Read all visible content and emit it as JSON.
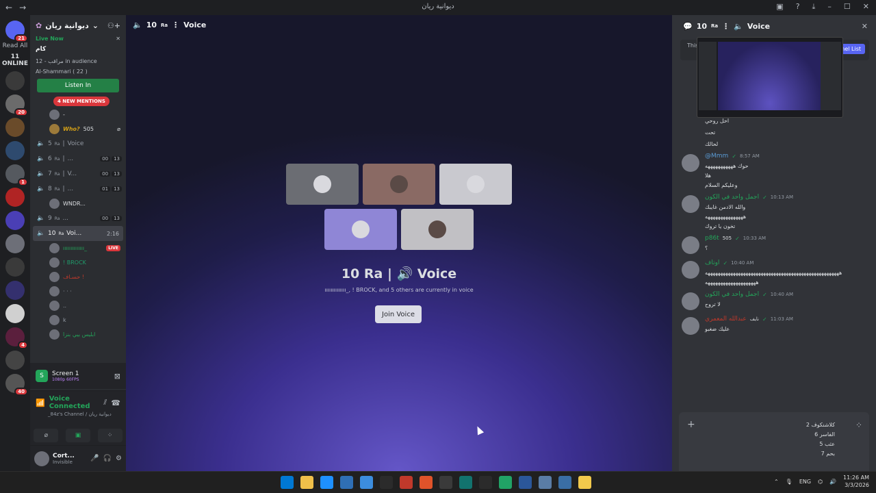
{
  "window": {
    "title": "ديوانية ريان",
    "nav_back": "←",
    "nav_forward": "→"
  },
  "rail": {
    "read_all": "Read All",
    "online": "11 ONLINE",
    "home_badge": "21",
    "servers": [
      {
        "color": "#3a3a3a",
        "badge": ""
      },
      {
        "color": "#6b6b6b",
        "badge": "20"
      },
      {
        "color": "#6a4b2a",
        "badge": ""
      },
      {
        "color": "#2e4a6e",
        "badge": ""
      },
      {
        "color": "#55595f",
        "badge": "1"
      },
      {
        "color": "#b02424",
        "badge": ""
      },
      {
        "color": "#4a3fb5",
        "badge": ""
      },
      {
        "color": "#6d6f78",
        "badge": ""
      },
      {
        "color": "#3a3a3a",
        "badge": ""
      },
      {
        "color": "#34306e",
        "badge": ""
      },
      {
        "color": "#d0d0d0",
        "badge": ""
      },
      {
        "color": "#5b1f3d",
        "badge": "4"
      },
      {
        "color": "#444",
        "badge": ""
      },
      {
        "color": "#555",
        "badge": "40"
      }
    ]
  },
  "sidebar": {
    "guild_name": "ديوانية ريان",
    "live_now": "Live Now",
    "live_channel": "كام",
    "audience": "مراقب - 12 in audience",
    "streamer": "Al-Shammari ( 22 )",
    "listen_in": "Listen In",
    "new_mentions": "4 NEW MENTIONS",
    "who_user": "Who?",
    "who_tag": "505",
    "channels": [
      {
        "num": "5",
        "sup": "Ra",
        "name": "Voice",
        "a": "",
        "b": ""
      },
      {
        "num": "6",
        "sup": "Ra",
        "name": "...",
        "a": "00",
        "b": "13"
      },
      {
        "num": "7",
        "sup": "Ra",
        "name": "V...",
        "a": "00",
        "b": "13"
      },
      {
        "num": "8",
        "sup": "Ra",
        "name": "...",
        "a": "01",
        "b": "13"
      }
    ],
    "ch8_user": "WNDR...",
    "ch9": {
      "num": "9",
      "sup": "Ra",
      "name": "...",
      "a": "00",
      "b": "13"
    },
    "active_channel": {
      "num": "10",
      "sup": "Ra",
      "name": "Voi...",
      "timer": "2:16"
    },
    "live_tag": "LIVE",
    "voice_users": [
      {
        "name": "ıııııııııııııı_",
        "color": "#23a55a"
      },
      {
        "name": "! BROCK",
        "color": "#1f9c6b"
      },
      {
        "name": "حسـاف !",
        "color": "#c0392b"
      },
      {
        "name": "· · ·",
        "color": "#949ba4"
      },
      {
        "name": "..",
        "color": "#949ba4"
      },
      {
        "name": "k",
        "color": "#949ba4"
      },
      {
        "name": "ابليس بيي بنزا",
        "color": "#23a55a"
      }
    ],
    "screen_title": "Screen 1",
    "screen_sub": "1080p 60FPS",
    "voice_connected": "Voice Connected",
    "voice_channel": "_84z's Channel / ديوانية ريان",
    "username": "Cort...",
    "status": "Invisible"
  },
  "stage": {
    "channel_num": "10",
    "channel_sup": "Ra",
    "channel_name": "Voice",
    "title": "10 Ra  |  🔊 Voice",
    "subtitle": "ıııııııııııııı_, ! BROCK, and 5 others are currently in voice",
    "join_label": "Join Voice",
    "tiles_row1": [
      "#6b6d73",
      "#8a6a64",
      "#c9c9cf"
    ],
    "tiles_row2": [
      "#8f86d6",
      "#c1c0c4"
    ]
  },
  "chat": {
    "header_num": "10",
    "header_sup": "Ra",
    "header_name": "Voice",
    "notice_text": "This ... list",
    "channel_list_btn": "nnel List",
    "early_lines": [
      "احل روحي",
      "تحت",
      "لحالك"
    ],
    "messages": [
      {
        "name": "@Mmm",
        "name_color": "#5a9bd5",
        "time": "8:57 AM",
        "lines": [
          "حوك هههههههههههه",
          "هلا",
          "وعليكم السلام"
        ]
      },
      {
        "name": "اجمل واحد في الكون",
        "name_color": "#23a55a",
        "time": "10:13 AM",
        "lines": [
          "والله الادمن غايبك",
          "هههههههههههههههه",
          "تخون يا تروك"
        ]
      },
      {
        "name": "p86t",
        "name_color": "#23a55a",
        "time": "10:33 AM",
        "tag": "505",
        "lines": [
          "؟"
        ]
      },
      {
        "name": "اوتاف",
        "name_color": "#23a55a",
        "time": "10:40 AM",
        "lines": [
          "هههههههههههههههههههههههههههههههههههههههههههههههههههههه",
          "ههههههههههههههههههههه"
        ]
      },
      {
        "name": "اجمل واحد في الكون",
        "name_color": "#23a55a",
        "time": "10:40 AM",
        "lines": [
          "لا تروح"
        ]
      },
      {
        "name": "عبدالله المعمري",
        "name_color": "#c0392b",
        "time": "11:03 AM",
        "tag": "نايف",
        "lines": [
          "عليك ضغبو"
        ]
      }
    ],
    "draft": "2 كلاشنكوف\n6 الفاسر\n5 عثب\n7 بحم",
    "plus": "+",
    "close": "✕"
  },
  "taskbar": {
    "apps": [
      "#0078d4",
      "#f0c04a",
      "#1e90ff",
      "#2f6fb5",
      "#3c8dde",
      "#2b2b2b",
      "#c0392b",
      "#e0532a",
      "#3a3a3a",
      "#12736e",
      "#2b2b2b",
      "#21a366",
      "#2b579a",
      "#5a7da6",
      "#3a6ea5",
      "#f2c94c"
    ],
    "lang": "ENG",
    "time": "11:26 AM",
    "date": "3/3/2026"
  }
}
